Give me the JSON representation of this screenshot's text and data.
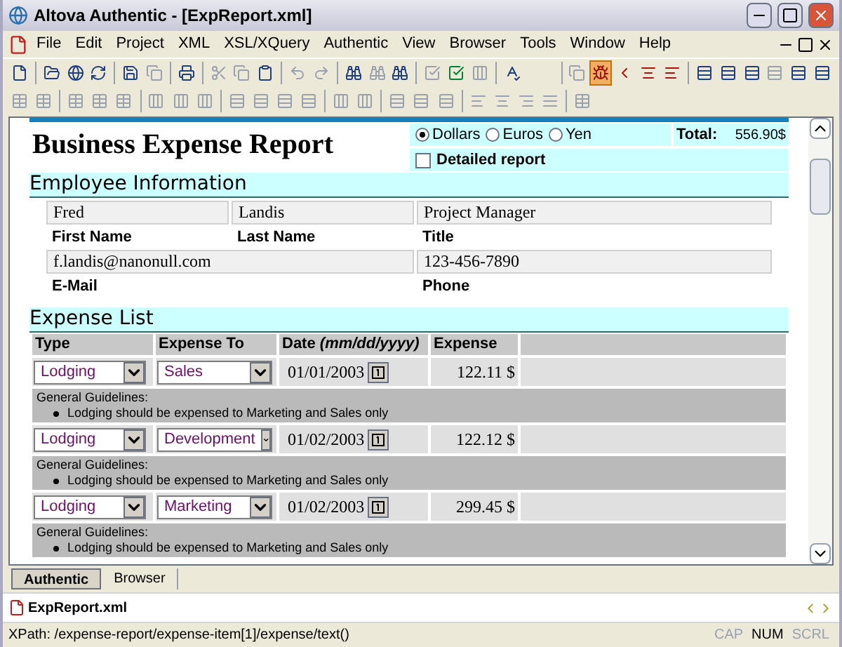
{
  "window": {
    "title": "Altova Authentic - [ExpReport.xml]"
  },
  "menu": [
    "File",
    "Edit",
    "Project",
    "XML",
    "XSL/XQuery",
    "Authentic",
    "View",
    "Browser",
    "Tools",
    "Window",
    "Help"
  ],
  "report": {
    "title": "Business Expense Report",
    "currencies": [
      {
        "label": "Dollars",
        "selected": true
      },
      {
        "label": "Euros",
        "selected": false
      },
      {
        "label": "Yen",
        "selected": false
      }
    ],
    "total_label": "Total:",
    "total": "556.90$",
    "detailed": {
      "label": "Detailed report",
      "checked": false
    }
  },
  "employee": {
    "heading": "Employee Information",
    "first_name": {
      "value": "Fred",
      "label": "First Name"
    },
    "last_name": {
      "value": "Landis",
      "label": "Last Name"
    },
    "title": {
      "value": "Project Manager",
      "label": "Title"
    },
    "email": {
      "value": "f.landis@nanonull.com",
      "label": "E-Mail"
    },
    "phone": {
      "value": "123-456-7890",
      "label": "Phone"
    }
  },
  "expenses": {
    "heading": "Expense List",
    "columns": [
      "Type",
      "Expense To",
      "Date ",
      "Expense"
    ],
    "date_format": "(mm/dd/yyyy)",
    "rows": [
      {
        "type": "Lodging",
        "expense_to": "Sales",
        "date": "01/01/2003",
        "expense": "122.11 $",
        "guidelines_title": "General Guidelines:",
        "guideline": "Lodging should be expensed to Marketing and Sales only"
      },
      {
        "type": "Lodging",
        "expense_to": "Development",
        "date": "01/02/2003",
        "expense": "122.12 $",
        "guidelines_title": "General Guidelines:",
        "guideline": "Lodging should be expensed to Marketing and Sales only"
      },
      {
        "type": "Lodging",
        "expense_to": "Marketing",
        "date": "01/02/2003",
        "expense": "299.45 $",
        "guidelines_title": "General Guidelines:",
        "guideline": "Lodging should be expensed to Marketing and Sales only"
      }
    ]
  },
  "view_tabs": [
    {
      "label": "Authentic",
      "selected": true
    },
    {
      "label": "Browser",
      "selected": false
    }
  ],
  "document_tab": {
    "label": "ExpReport.xml"
  },
  "status_bar": {
    "path": "XPath: /expense-report/expense-item[1]/expense/text()",
    "indicators": [
      {
        "label": "CAP",
        "on": false
      },
      {
        "label": "NUM",
        "on": true
      },
      {
        "label": "SCRL",
        "on": false
      }
    ]
  }
}
